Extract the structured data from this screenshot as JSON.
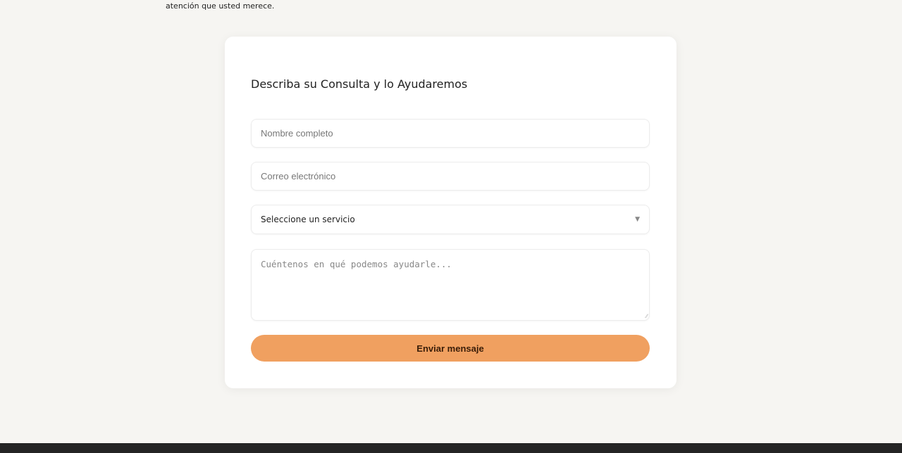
{
  "intro": {
    "text_tail": "atención que usted merece."
  },
  "form": {
    "title": "Describa su Consulta y lo Ayudaremos",
    "name_placeholder": "Nombre completo",
    "email_placeholder": "Correo electrónico",
    "service_selected": "Seleccione un servicio",
    "message_placeholder": "Cuéntenos en qué podemos ayudarle...",
    "submit_label": "Enviar mensaje"
  },
  "colors": {
    "accent": "#f0a060",
    "background": "#f6f5f2",
    "footer": "#242424"
  }
}
